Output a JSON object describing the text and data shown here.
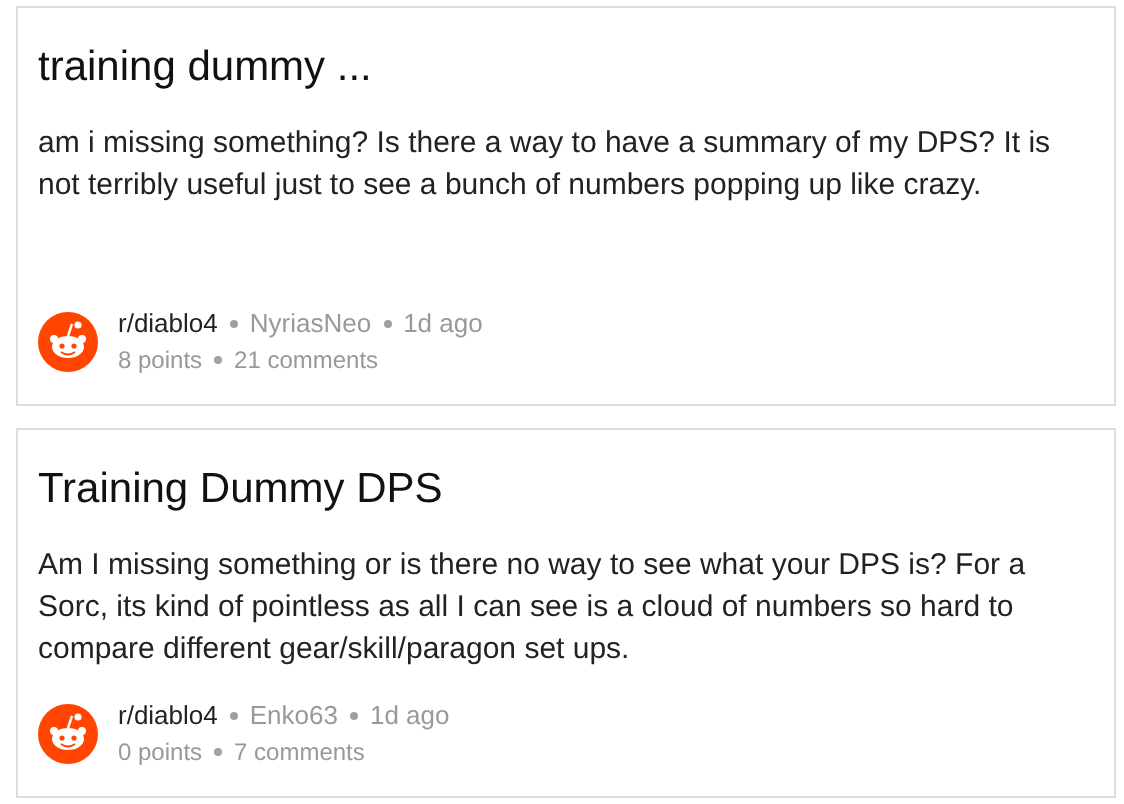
{
  "posts": [
    {
      "title": "training dummy ...",
      "body": "am i missing something? Is there a way to have a summary of my DPS? It is not terribly useful just to see a bunch of numbers popping up like crazy.",
      "subreddit": "r/diablo4",
      "author": "NyriasNeo",
      "time": "1d ago",
      "points": "8 points",
      "comments": "21 comments"
    },
    {
      "title": "Training Dummy DPS",
      "body": "Am I missing something or is there no way to see what your DPS is? For a Sorc, its kind of pointless as all I can see is a cloud of numbers so hard to compare different gear/skill/paragon set ups.",
      "subreddit": "r/diablo4",
      "author": "Enko63",
      "time": "1d ago",
      "points": "0 points",
      "comments": "7 comments"
    }
  ]
}
